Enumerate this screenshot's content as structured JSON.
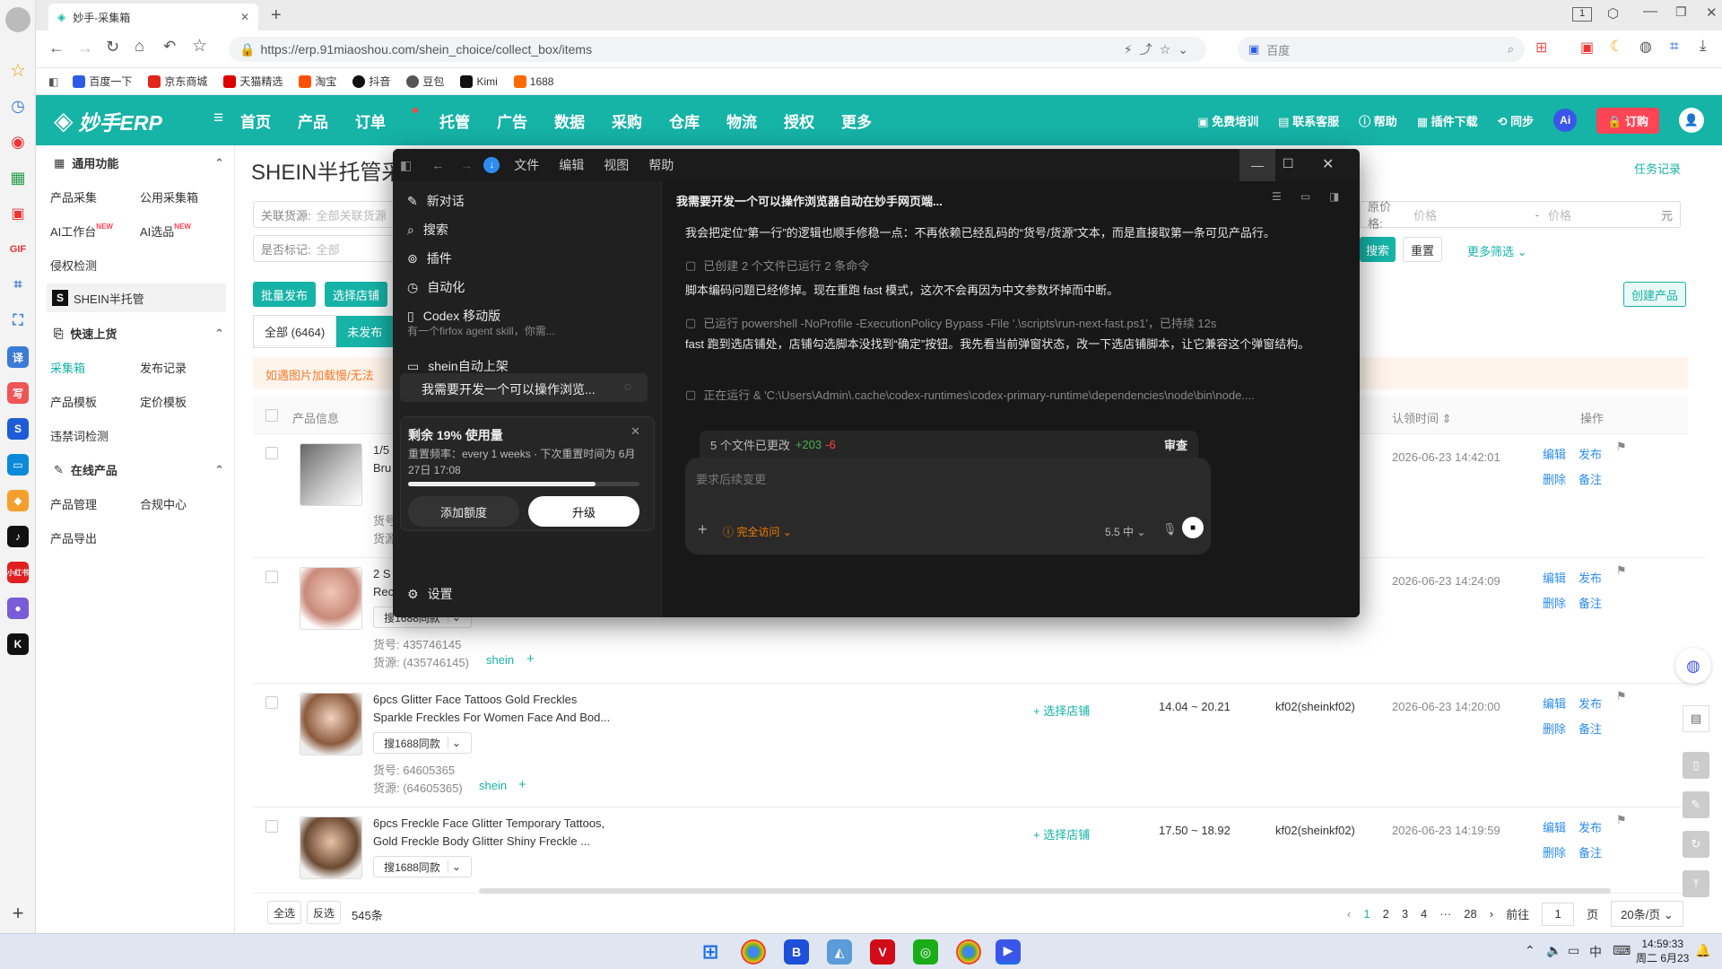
{
  "browser": {
    "tab_title": "妙手-采集箱",
    "url": "https://erp.91miaoshou.com/shein_choice/collect_box/items",
    "search_engine": "百度",
    "tab_count": "1",
    "bookmarks": [
      "百度一下",
      "京东商城",
      "天猫精选",
      "淘宝",
      "抖音",
      "豆包",
      "Kimi",
      "1688"
    ]
  },
  "erp": {
    "logo": "妙手ERP",
    "nav": [
      "首页",
      "产品",
      "订单",
      "托管",
      "广告",
      "数据",
      "采购",
      "仓库",
      "物流",
      "授权",
      "更多"
    ],
    "header_right": [
      "免费培训",
      "联系客服",
      "帮助",
      "插件下载",
      "同步"
    ],
    "ai": "Ai",
    "order_btn": "订购"
  },
  "sidebar": {
    "group1": "通用功能",
    "g1_items": [
      "产品采集",
      "公用采集箱",
      "AI工作台",
      "AI选品",
      "侵权检测"
    ],
    "new_tag": "NEW",
    "shein": "SHEIN半托管",
    "group2": "快速上货",
    "g2_items": [
      "采集箱",
      "发布记录",
      "产品模板",
      "定价模板",
      "违禁词检测"
    ],
    "group3": "在线产品",
    "g3_items": [
      "产品管理",
      "合规中心",
      "产品导出"
    ]
  },
  "main": {
    "title": "SHEIN半托管采",
    "task_link": "任务记录",
    "filter1_label": "关联货源:",
    "filter1_value": "全部关联货源",
    "filter2_label": "是否标记:",
    "filter2_value": "全部",
    "price_label": "原价格:",
    "price_ph1": "价格",
    "price_ph2": "价格",
    "price_unit": "元",
    "price_sep": "-",
    "search_btn": "搜索",
    "reset_btn": "重置",
    "more_filter": "更多筛选",
    "create_btn": "创建产品",
    "batch_btn": "批量发布",
    "select_store_btn": "选择店铺",
    "tab_all": "全部 (6464)",
    "tab_unpub": "未发布",
    "notice": "如遇图片加载慢/无法",
    "col_info": "产品信息",
    "col_time": "认领时间",
    "col_op": "操作",
    "op": [
      "编辑",
      "发布",
      "删除",
      "备注"
    ],
    "btn_1688": "搜1688同款",
    "select_store": "选择店铺",
    "rows": [
      {
        "title1": "1/5",
        "title2": "Bru",
        "sku": "货号",
        "src": "货源",
        "price": "",
        "store": "",
        "time": "2026-06-23 14:42:01"
      },
      {
        "title1": "2 S",
        "title2": "Rec",
        "sku": "货号: 435746145",
        "src": "货源: (435746145)",
        "price": "",
        "store": "",
        "time": "2026-06-23 14:24:09"
      },
      {
        "title1": "6pcs Glitter Face Tattoos Gold Freckles",
        "title2": "Sparkle Freckles For Women Face And Bod...",
        "sku": "货号: 64605365",
        "src": "货源: (64605365)",
        "price": "14.04 ~ 20.21",
        "store": "kf02(sheinkf02)",
        "time": "2026-06-23 14:20:00"
      },
      {
        "title1": "6pcs Freckle Face Glitter Temporary Tattoos,",
        "title2": "Gold Freckle Body Glitter Shiny Freckle ...",
        "sku": "",
        "src": "",
        "price": "17.50 ~ 18.92",
        "store": "kf02(sheinkf02)",
        "time": "2026-06-23 14:19:59"
      }
    ],
    "shein_tag": "shein",
    "footer_all": "全选",
    "footer_inv": "反选",
    "footer_count": "545条",
    "pages": [
      "1",
      "2",
      "3",
      "4",
      "28"
    ],
    "goto": "前往",
    "page_input": "1",
    "page_unit": "页",
    "page_size": "20条/页"
  },
  "codex": {
    "menu": [
      "文件",
      "编辑",
      "视图",
      "帮助"
    ],
    "side_items": [
      "新对话",
      "搜索",
      "插件",
      "自动化",
      "Codex 移动版"
    ],
    "project": "shein自动上架",
    "thread": "我需要开发一个可以操作浏览...",
    "hidden_line": "有一个firfox agent skill，你需...",
    "usage_title": "剩余 19% 使用量",
    "usage_desc": "重置频率：every 1 weeks · 下次重置时间为 6月27日 17:08",
    "usage_remaining": 0.81,
    "add_quota": "添加额度",
    "upgrade": "升级",
    "settings": "设置",
    "chat_title": "我需要开发一个可以操作浏览器自动在妙手网页端...",
    "msg1": "我会把定位“第一行”的逻辑也顺手修稳一点：不再依赖已经乱码的“货号/货源”文本，而是直接取第一条可见产品行。",
    "status1": "已创建 2 个文件已运行 2 条命令",
    "msg2": "脚本编码问题已经修掉。现在重跑 fast 模式，这次不会再因为中文参数坏掉而中断。",
    "status2": "已运行 powershell -NoProfile -ExecutionPolicy Bypass -File '.\\scripts\\run-next-fast.ps1'，已持续 12s",
    "msg3": "fast 跑到选店铺处，店铺勾选脚本没找到“确定”按钮。我先看当前弹窗状态，改一下选店铺脚本，让它兼容这个弹窗结构。",
    "status3": "正在运行 & 'C:\\Users\\Admin\\.cache\\codex-runtimes\\codex-primary-runtime\\dependencies\\node\\bin\\node....",
    "changes": "5 个文件已更改",
    "plus": "+203",
    "minus": "-6",
    "review": "审查",
    "input_ph": "要求后续变更",
    "access": "完全访问",
    "model": "5.5",
    "effort": "中"
  },
  "taskbar": {
    "time": "14:59:33",
    "date": "周二 6月23",
    "ime": "中"
  }
}
